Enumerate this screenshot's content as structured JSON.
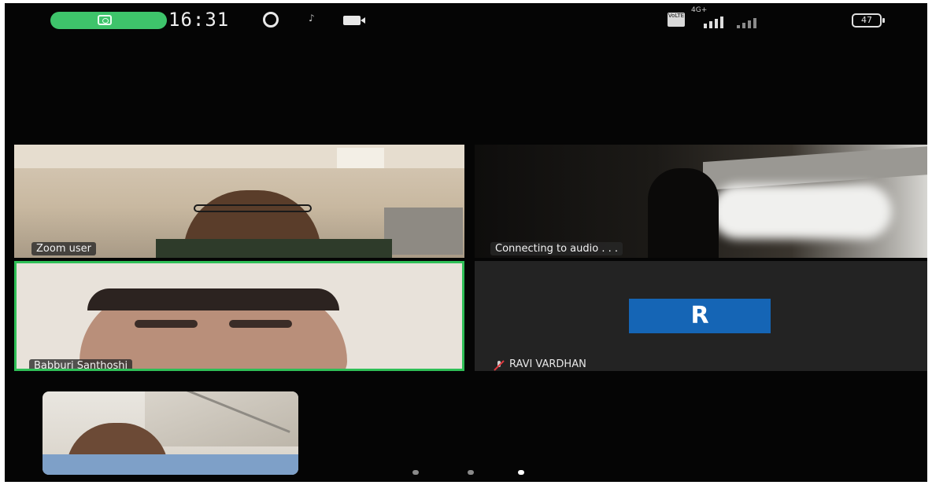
{
  "status_bar": {
    "time": "16:31",
    "battery": "47",
    "network": "4G+",
    "volte": "VoLTE"
  },
  "participants": [
    {
      "name": "Zoom user",
      "active_speaker": false
    },
    {
      "name": "Connecting to audio . . .",
      "active_speaker": false
    },
    {
      "name": "Babburi Santhoshi",
      "active_speaker": true
    },
    {
      "name": "RAVI VARDHAN",
      "avatar_letter": "R",
      "muted": true,
      "active_speaker": false
    },
    {
      "name": "",
      "self_view": true
    }
  ],
  "pager": {
    "pages": 3,
    "current": 3
  },
  "colors": {
    "speaker_border": "#2fbf57",
    "avatar": "#1565b5",
    "pill": "#3ec46b"
  }
}
